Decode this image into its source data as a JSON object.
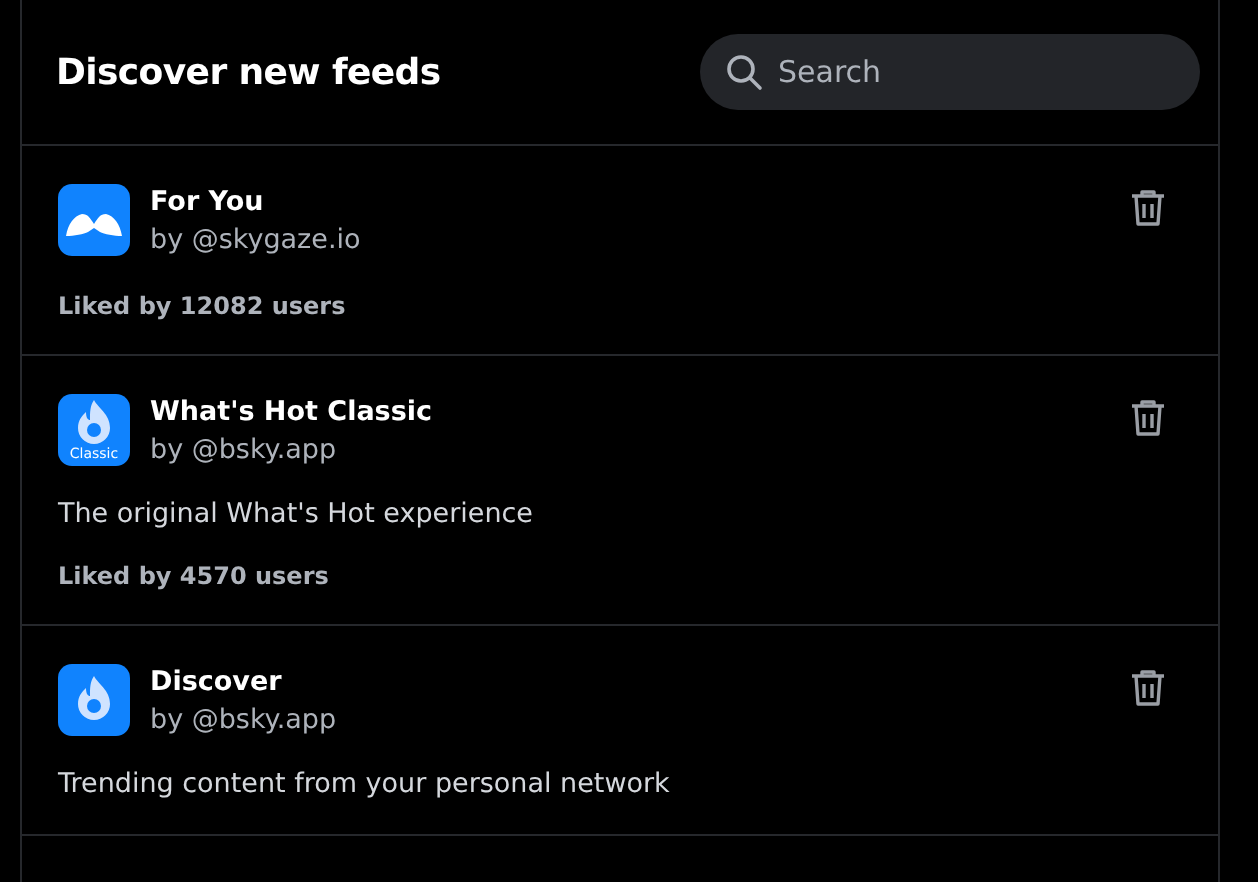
{
  "header": {
    "title": "Discover new feeds"
  },
  "search": {
    "placeholder": "Search"
  },
  "feeds": [
    {
      "name": "For You",
      "author": "by @skygaze.io",
      "avatar": {
        "kind": "hands"
      },
      "likes": "Liked by 12082 users"
    },
    {
      "name": "What's Hot Classic",
      "author": "by @bsky.app",
      "avatar": {
        "kind": "flame",
        "label": "Classic"
      },
      "description": "The original What's Hot experience",
      "likes": "Liked by 4570 users"
    },
    {
      "name": "Discover",
      "author": "by @bsky.app",
      "avatar": {
        "kind": "flame"
      },
      "description": "Trending content from your personal network"
    }
  ]
}
